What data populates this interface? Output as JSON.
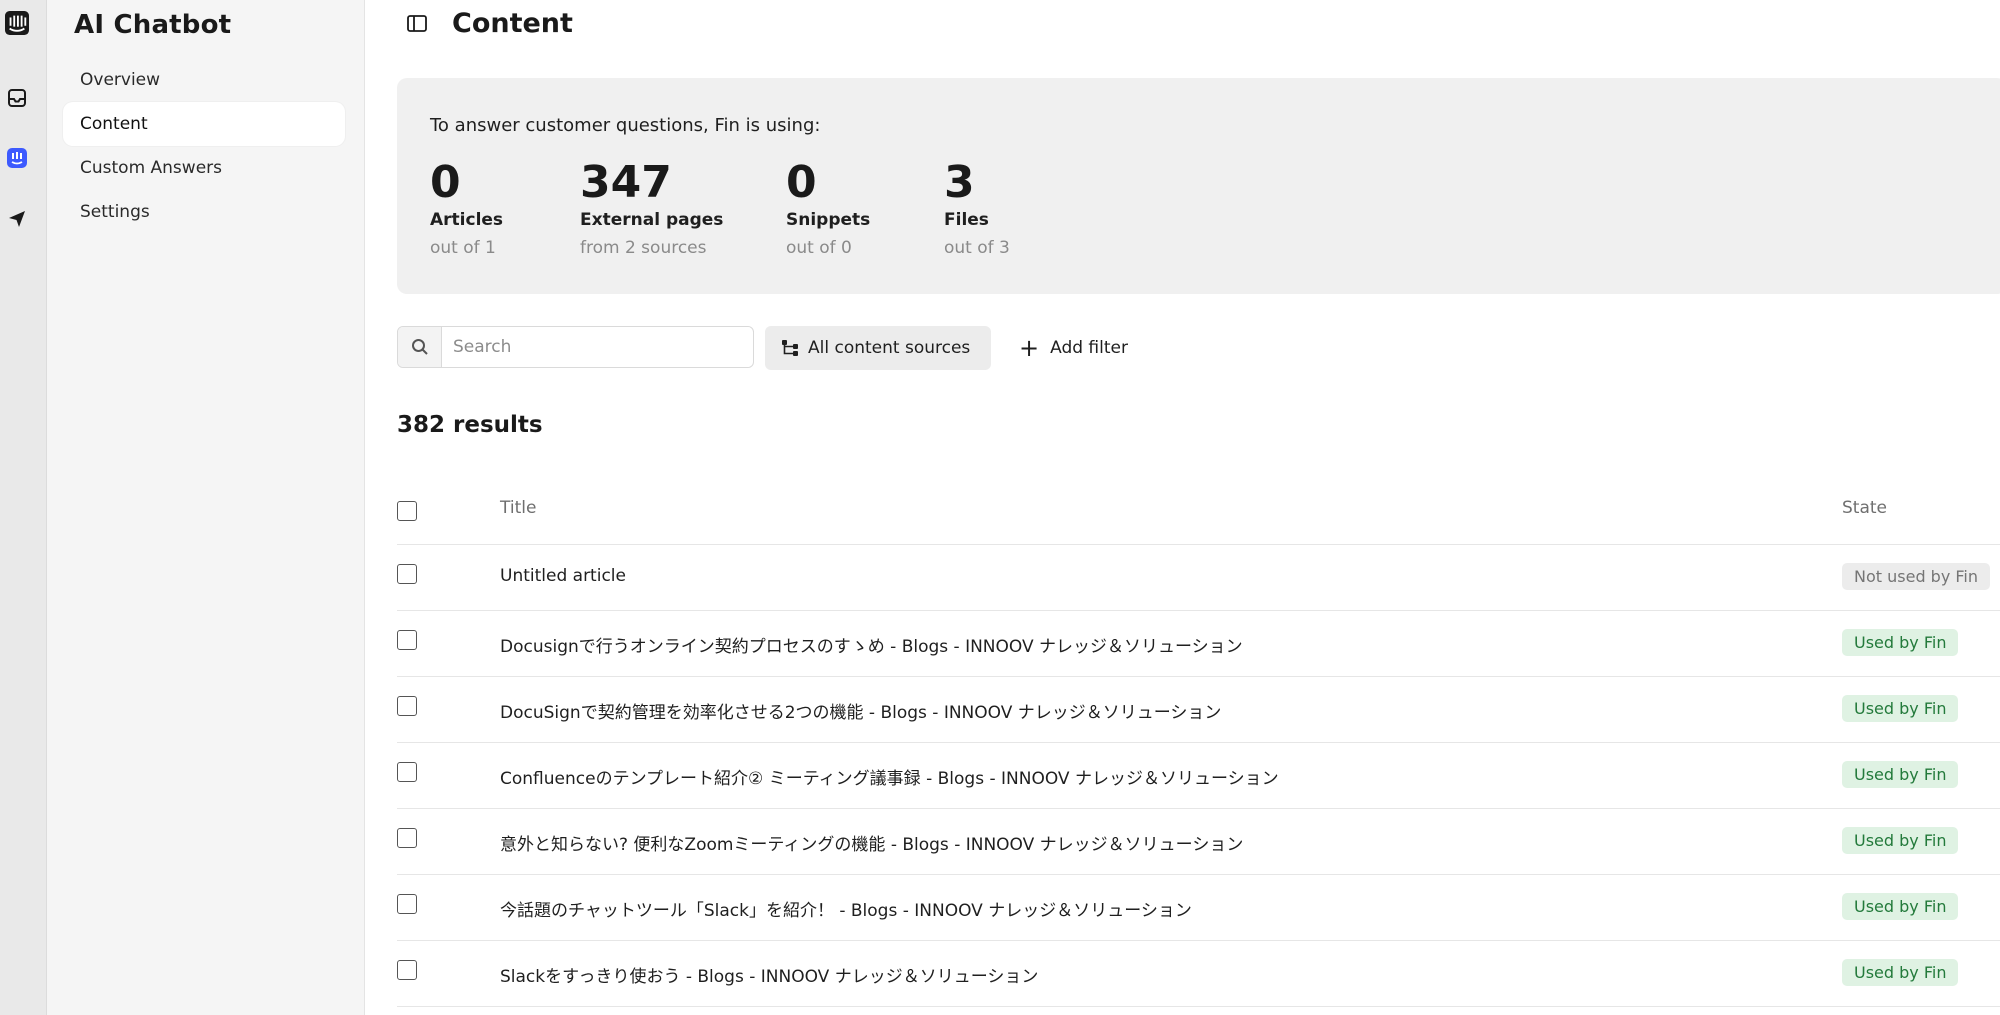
{
  "app": {
    "section_title": "AI Chatbot",
    "rail_icons": [
      "intercom-logo-icon",
      "inbox-icon",
      "fin-bot-icon",
      "outbound-send-icon"
    ]
  },
  "sidebar": {
    "items": [
      {
        "label": "Overview",
        "active": false
      },
      {
        "label": "Content",
        "active": true
      },
      {
        "label": "Custom Answers",
        "active": false
      },
      {
        "label": "Settings",
        "active": false
      }
    ]
  },
  "header": {
    "title": "Content",
    "toggle_icon": "sidebar-toggle-icon"
  },
  "summary": {
    "intro": "To answer customer questions, Fin is using:",
    "stats": [
      {
        "value": "0",
        "label": "Articles",
        "sub": "out of 1"
      },
      {
        "value": "347",
        "label": "External pages",
        "sub": "from 2 sources"
      },
      {
        "value": "0",
        "label": "Snippets",
        "sub": "out of 0"
      },
      {
        "value": "3",
        "label": "Files",
        "sub": "out of 3"
      }
    ]
  },
  "toolbar": {
    "search_placeholder": "Search",
    "sources_label": "All content sources",
    "add_filter_label": "Add filter"
  },
  "results": {
    "count_label": "382 results"
  },
  "table": {
    "columns": {
      "title": "Title",
      "state": "State"
    },
    "rows": [
      {
        "title": "Untitled article",
        "state": "Not used by Fin",
        "used": false
      },
      {
        "title": "Docusignで行うオンライン契約プロセスのすゝめ - Blogs - INNOOV ナレッジ＆ソリューション",
        "state": "Used by Fin",
        "used": true
      },
      {
        "title": "DocuSignで契約管理を効率化させる2つの機能 - Blogs - INNOOV ナレッジ＆ソリューション",
        "state": "Used by Fin",
        "used": true
      },
      {
        "title": "Confluenceのテンプレート紹介② ミーティング議事録 - Blogs - INNOOV ナレッジ＆ソリューション",
        "state": "Used by Fin",
        "used": true
      },
      {
        "title": "意外と知らない? 便利なZoomミーティングの機能 - Blogs - INNOOV ナレッジ＆ソリューション",
        "state": "Used by Fin",
        "used": true
      },
      {
        "title": "今話題のチャットツール「Slack」を紹介！ - Blogs - INNOOV ナレッジ＆ソリューション",
        "state": "Used by Fin",
        "used": true
      },
      {
        "title": "Slackをすっきり使おう - Blogs - INNOOV ナレッジ＆ソリューション",
        "state": "Used by Fin",
        "used": true
      }
    ]
  },
  "colors": {
    "used_badge_bg": "#dff2e3",
    "used_badge_text": "#237a3b",
    "unused_badge_bg": "#ececec",
    "unused_badge_text": "#757575",
    "fin_accent": "#3d5afe"
  }
}
